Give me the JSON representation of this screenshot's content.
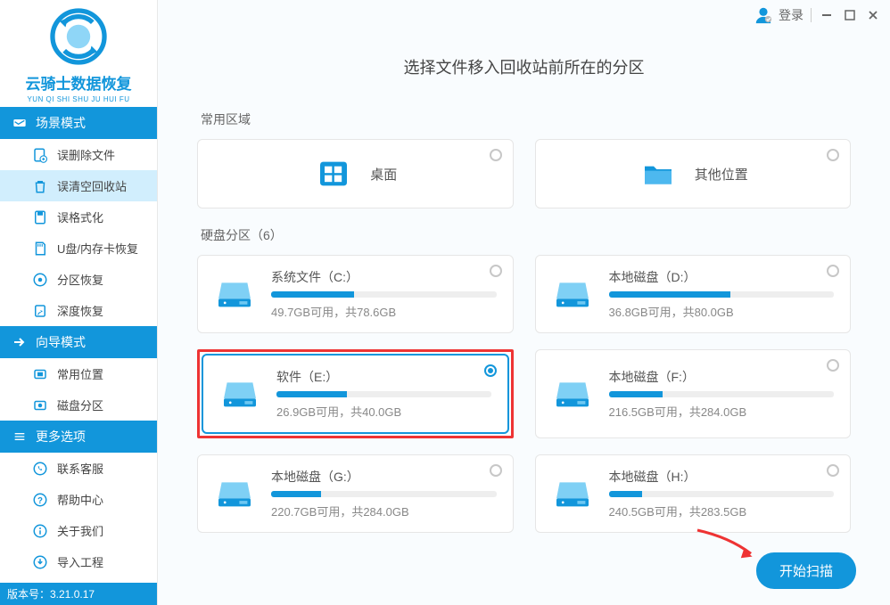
{
  "app": {
    "name": "云骑士数据恢复",
    "pinyin": "YUN QI SHI SHU JU HUI FU",
    "version_label": "版本号：3.21.0.17"
  },
  "titlebar": {
    "login": "登录"
  },
  "sidebar": {
    "scene_mode": "场景模式",
    "wizard_mode": "向导模式",
    "more_options": "更多选项",
    "scene_items": [
      {
        "label": "误删除文件"
      },
      {
        "label": "误清空回收站"
      },
      {
        "label": "误格式化"
      },
      {
        "label": "U盘/内存卡恢复"
      },
      {
        "label": "分区恢复"
      },
      {
        "label": "深度恢复"
      }
    ],
    "wizard_items": [
      {
        "label": "常用位置"
      },
      {
        "label": "磁盘分区"
      }
    ],
    "more_items": [
      {
        "label": "联系客服"
      },
      {
        "label": "帮助中心"
      },
      {
        "label": "关于我们"
      },
      {
        "label": "导入工程"
      }
    ]
  },
  "main": {
    "heading": "选择文件移入回收站前所在的分区",
    "common_area_label": "常用区域",
    "disk_area_label": "硬盘分区（6）",
    "common_cards": [
      {
        "label": "桌面"
      },
      {
        "label": "其他位置"
      }
    ],
    "drives": [
      {
        "name": "系统文件（C:）",
        "free_text": "49.7GB可用，共78.6GB",
        "fill_pct": 37
      },
      {
        "name": "本地磁盘（D:）",
        "free_text": "36.8GB可用，共80.0GB",
        "fill_pct": 54
      },
      {
        "name": "软件（E:）",
        "free_text": "26.9GB可用，共40.0GB",
        "fill_pct": 33,
        "selected": true
      },
      {
        "name": "本地磁盘（F:）",
        "free_text": "216.5GB可用，共284.0GB",
        "fill_pct": 24
      },
      {
        "name": "本地磁盘（G:）",
        "free_text": "220.7GB可用，共284.0GB",
        "fill_pct": 22
      },
      {
        "name": "本地磁盘（H:）",
        "free_text": "240.5GB可用，共283.5GB",
        "fill_pct": 15
      }
    ],
    "scan_button": "开始扫描"
  }
}
